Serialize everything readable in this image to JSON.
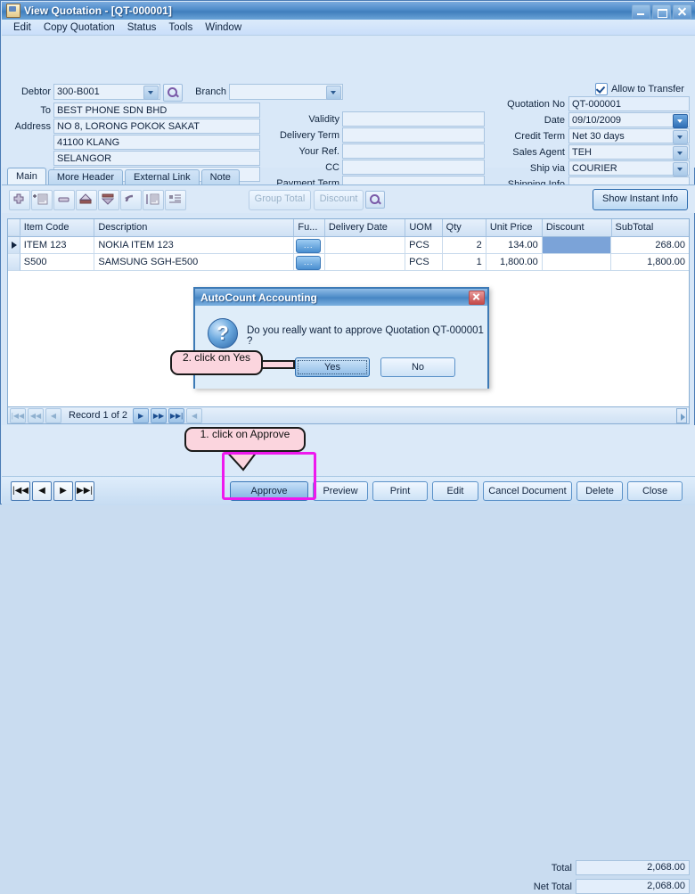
{
  "window": {
    "title": "View Quotation - [QT-000001]",
    "icon": "document-icon",
    "buttons": {
      "minimize": "minimize-icon",
      "maximize": "maximize-icon",
      "close": "close-icon"
    }
  },
  "menubar": {
    "items": [
      "Edit",
      "Copy Quotation",
      "Status",
      "Tools",
      "Window"
    ]
  },
  "header": {
    "debtor_label": "Debtor",
    "debtor_value": "300-B001",
    "search_icon": "magnifier-icon",
    "branch_label": "Branch",
    "branch_value": "",
    "to_label": "To",
    "to_value": "BEST PHONE SDN BHD",
    "address_label": "Address",
    "address_lines": [
      "NO 8, LORONG POKOK SAKAT",
      "41100 KLANG",
      "SELANGOR",
      ""
    ],
    "middle_fields": [
      {
        "label": "Validity",
        "value": ""
      },
      {
        "label": "Delivery Term",
        "value": ""
      },
      {
        "label": "Your Ref.",
        "value": ""
      },
      {
        "label": "CC",
        "value": ""
      },
      {
        "label": "Payment Term",
        "value": ""
      }
    ],
    "allow_transfer_label": "Allow to Transfer",
    "allow_transfer_checked": true,
    "right_fields": [
      {
        "label": "Quotation No",
        "value": "QT-000001",
        "combo": false
      },
      {
        "label": "Date",
        "value": "09/10/2009",
        "combo": true,
        "active": true
      },
      {
        "label": "Credit Term",
        "value": "Net 30 days",
        "combo": true,
        "active": false
      },
      {
        "label": "Sales Agent",
        "value": "TEH",
        "combo": true,
        "active": false
      },
      {
        "label": "Ship via",
        "value": "COURIER",
        "combo": true,
        "active": false
      },
      {
        "label": "Shipping Info",
        "value": "",
        "combo": false
      }
    ]
  },
  "tabs": [
    {
      "label": "Main",
      "selected": true
    },
    {
      "label": "More Header",
      "selected": false
    },
    {
      "label": "External Link",
      "selected": false
    },
    {
      "label": "Note",
      "selected": false
    }
  ],
  "grid_toolbar": {
    "icons": [
      "add-row-icon",
      "insert-row-icon",
      "delete-row-icon",
      "move-up-icon",
      "move-down-icon",
      "undo-icon",
      "indent-icon",
      "outdent-icon"
    ],
    "group_total_label": "Group Total",
    "discount_label": "Discount",
    "find_icon": "magnifier-icon",
    "show_instant_info_label": "Show Instant Info"
  },
  "grid": {
    "columns": [
      "Item Code",
      "Description",
      "Fu...",
      "Delivery Date",
      "UOM",
      "Qty",
      "Unit Price",
      "Discount",
      "SubTotal"
    ],
    "rows": [
      {
        "current": true,
        "item_code": "ITEM 123",
        "description": "NOKIA ITEM 123",
        "furtherdesc": "...",
        "delivery_date": "",
        "uom": "PCS",
        "qty": "2",
        "unit_price": "134.00",
        "discount": "",
        "discount_selected": true,
        "subtotal": "268.00"
      },
      {
        "current": false,
        "item_code": "S500",
        "description": "SAMSUNG SGH-E500",
        "furtherdesc": "...",
        "delivery_date": "",
        "uom": "PCS",
        "qty": "1",
        "unit_price": "1,800.00",
        "discount": "",
        "discount_selected": false,
        "subtotal": "1,800.00"
      }
    ]
  },
  "record_nav": {
    "text": "Record 1 of 2",
    "buttons": [
      "first-record-icon",
      "prev-page-icon",
      "prev-record-icon",
      "next-record-icon",
      "next-page-icon",
      "last-record-icon",
      "collapse-icon"
    ]
  },
  "totals": [
    {
      "label": "Total",
      "value": "2,068.00"
    },
    {
      "label": "Net Total",
      "value": "2,068.00"
    }
  ],
  "footer": {
    "nav_buttons": [
      "first-icon",
      "prev-icon",
      "next-icon",
      "last-icon"
    ],
    "buttons": [
      {
        "label": "Approve",
        "primary": true,
        "highlighted": true
      },
      {
        "label": "Preview",
        "primary": false,
        "highlighted": false
      },
      {
        "label": "Print",
        "primary": false,
        "highlighted": false
      },
      {
        "label": "Edit",
        "primary": false,
        "highlighted": false
      },
      {
        "label": "Cancel Document",
        "primary": false,
        "highlighted": false
      },
      {
        "label": "Delete",
        "primary": false,
        "highlighted": false
      },
      {
        "label": "Close",
        "primary": false,
        "highlighted": false
      }
    ]
  },
  "dialog": {
    "title": "AutoCount Accounting",
    "close_icon": "close-icon",
    "question_icon": "question-mark-icon",
    "message": "Do you really want to approve Quotation QT-000001 ?",
    "yes_label": "Yes",
    "no_label": "No"
  },
  "annotations": [
    {
      "id": "step2",
      "text": "2. click on Yes"
    },
    {
      "id": "step1",
      "text": "1. click on Approve"
    }
  ],
  "colors": {
    "window_bg": "#d9e8f8",
    "title_blue": "#4e8bc9",
    "callout_pink": "#fbd5de",
    "highlight_magenta": "#ee19ee",
    "grid_cell_selected": "#7ba3d8"
  }
}
